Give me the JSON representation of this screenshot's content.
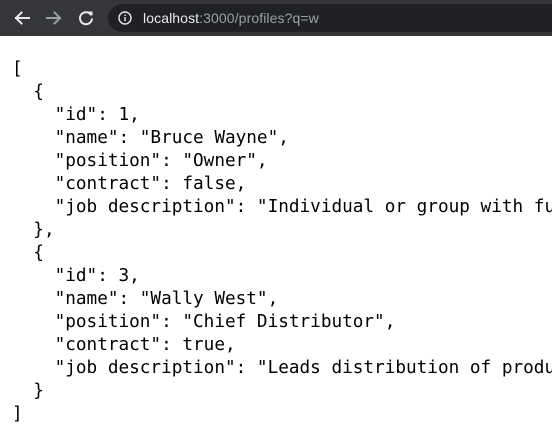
{
  "browser": {
    "back_icon": "arrow-left-icon",
    "forward_icon": "arrow-right-icon",
    "reload_icon": "reload-icon",
    "site_info_icon": "info-icon",
    "url_host": "localhost",
    "url_rest": ":3000/profiles?q=w"
  },
  "json_lines": [
    "[",
    "  {",
    "    \"id\": 1,",
    "    \"name\": \"Bruce Wayne\",",
    "    \"position\": \"Owner\",",
    "    \"contract\": false,",
    "    \"job description\": \"Individual or group with fu",
    "  },",
    "  {",
    "    \"id\": 3,",
    "    \"name\": \"Wally West\",",
    "    \"position\": \"Chief Distributor\",",
    "    \"contract\": true,",
    "    \"job description\": \"Leads distribution of produ",
    "  }",
    "]"
  ]
}
